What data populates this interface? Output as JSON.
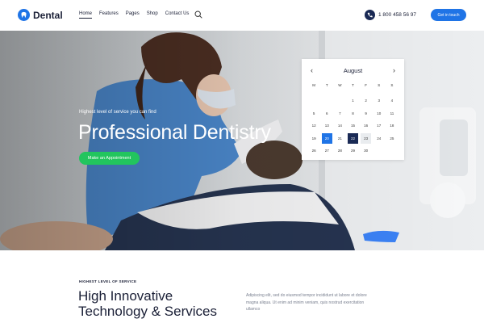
{
  "brand": {
    "name": "Dental",
    "accent": "#1f74e6",
    "navy": "#1a2a55",
    "green": "#22c55e"
  },
  "nav": {
    "items": [
      {
        "label": "Home",
        "active": true
      },
      {
        "label": "Features"
      },
      {
        "label": "Pages"
      },
      {
        "label": "Shop"
      },
      {
        "label": "Contact Us"
      }
    ],
    "search_icon": "search-icon"
  },
  "header": {
    "phone": "1 800 458 56 97",
    "phone_icon": "phone-icon",
    "cta": "Get in touch"
  },
  "hero": {
    "subtitle": "Highest level of service you can find",
    "title": "Professional Dentistry",
    "button": "Make an Appointment"
  },
  "calendar": {
    "month": "August",
    "prev": "‹",
    "next": "›",
    "weekdays": [
      "M",
      "T",
      "W",
      "T",
      "F",
      "S",
      "S"
    ],
    "weeks": [
      [
        "",
        "",
        "",
        "1",
        "2",
        "3",
        "4"
      ],
      [
        "5",
        "6",
        "7",
        "8",
        "9",
        "10",
        "11"
      ],
      [
        "12",
        "13",
        "14",
        "15",
        "16",
        "17",
        "18"
      ],
      [
        "19",
        "20",
        "21",
        "22",
        "23",
        "24",
        "25"
      ],
      [
        "26",
        "27",
        "28",
        "29",
        "30",
        "",
        ""
      ]
    ],
    "today": "20",
    "selected": "22",
    "hover": "23"
  },
  "section": {
    "kicker": "HIGHEST LEVEL OF SERVICE",
    "title_line1": "High Innovative",
    "title_line2": "Technology & Services",
    "text": "Adipiscing elit, sed do eiusmod tempor incididunt ut labore et dolore magna aliqua. Ut enim ad minim veniam, quis nostrud exercitation ullamco"
  }
}
